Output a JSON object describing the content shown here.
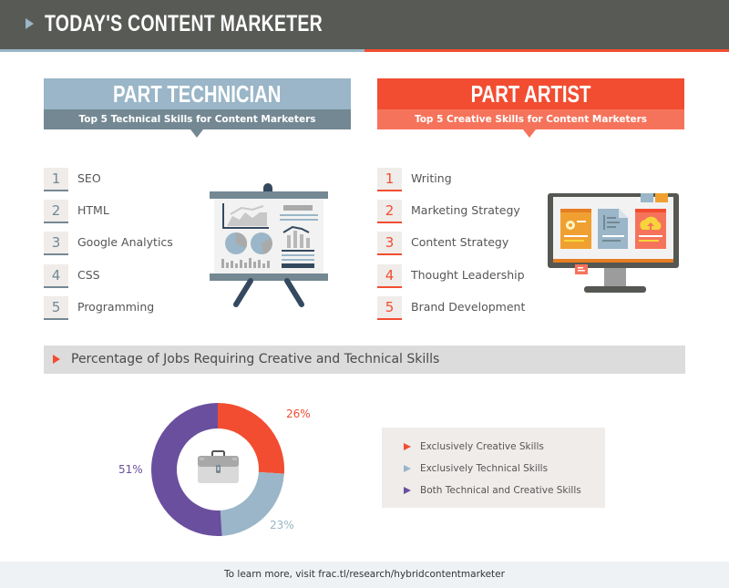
{
  "header": {
    "title": "TODAY'S CONTENT MARKETER",
    "marker_icon": "triangle-right-icon"
  },
  "colors": {
    "header_bg": "#585a55",
    "tech_primary": "#9ab6c8",
    "tech_secondary": "#748893",
    "art_primary": "#f24d31",
    "art_secondary": "#f6735b",
    "both_purple": "#6a4f9f",
    "panel_bg": "#efecea",
    "section_bg": "#dcdcdc",
    "footer_bg": "#eff2f4"
  },
  "technician": {
    "title": "PART TECHNICIAN",
    "subtitle": "Top 5 Technical Skills for Content Marketers",
    "skills": [
      {
        "rank": "1",
        "label": "SEO"
      },
      {
        "rank": "2",
        "label": "HTML"
      },
      {
        "rank": "3",
        "label": "Google Analytics"
      },
      {
        "rank": "4",
        "label": "CSS"
      },
      {
        "rank": "5",
        "label": "Programming"
      }
    ],
    "illustration": "presentation-easel-icon"
  },
  "artist": {
    "title": "PART ARTIST",
    "subtitle": "Top 5 Creative Skills for Content Marketers",
    "skills": [
      {
        "rank": "1",
        "label": "Writing"
      },
      {
        "rank": "2",
        "label": "Marketing Strategy"
      },
      {
        "rank": "3",
        "label": "Content Strategy"
      },
      {
        "rank": "4",
        "label": "Thought Leadership"
      },
      {
        "rank": "5",
        "label": "Brand Development"
      }
    ],
    "illustration": "desktop-monitor-icon"
  },
  "section": {
    "title": "Percentage of Jobs Requiring Creative and Technical Skills"
  },
  "chart_data": {
    "type": "pie",
    "variant": "donut",
    "title": "Percentage of Jobs Requiring Creative and Technical Skills",
    "center_icon": "toolbox-icon",
    "categories": [
      "Exclusively Creative Skills",
      "Exclusively Technical Skills",
      "Both Technical and Creative Skills"
    ],
    "values": [
      26,
      23,
      51
    ],
    "unit": "%",
    "labels": [
      "26%",
      "23%",
      "51%"
    ],
    "colors": [
      "#f24d31",
      "#9ab6c8",
      "#6a4f9f"
    ],
    "legend_placement": "right"
  },
  "footer": {
    "text": "To learn more, visit frac.tl/research/hybridcontentmarketer"
  }
}
